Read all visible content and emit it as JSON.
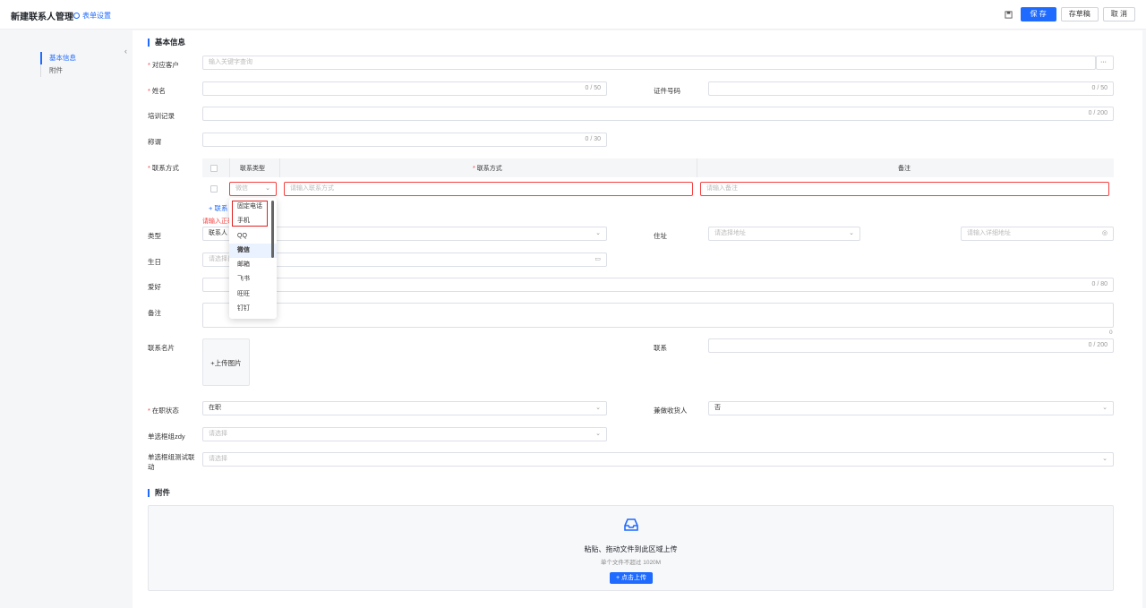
{
  "header": {
    "title": "新建联系人管理",
    "form_settings": "表单设置",
    "save": "保 存",
    "draft": "存草稿",
    "cancel": "取 消"
  },
  "sidebar": {
    "items": [
      {
        "label": "基本信息",
        "active": true
      },
      {
        "label": "附件",
        "active": false
      }
    ]
  },
  "sections": {
    "basic": "基本信息",
    "attachment": "附件"
  },
  "fields": {
    "customer": {
      "label": "对应客户",
      "placeholder": "输入关键字查询",
      "more": "···"
    },
    "name": {
      "label": "姓名",
      "count": "0 / 50"
    },
    "id_number": {
      "label": "证件号码",
      "count": "0 / 50"
    },
    "training": {
      "label": "培训记录",
      "count": "0 / 200"
    },
    "title": {
      "label": "称谓",
      "count": "0 / 30"
    },
    "contact_method": {
      "label": "联系方式"
    },
    "type": {
      "label": "类型",
      "value": "联系人"
    },
    "address": {
      "label": "住址",
      "placeholder": "请选择地址",
      "detail_placeholder": "请输入详细地址"
    },
    "birthday": {
      "label": "生日",
      "placeholder": "请选择日期"
    },
    "hobby": {
      "label": "爱好",
      "count": "0 / 80"
    },
    "remark": {
      "label": "备注",
      "count": "0"
    },
    "card": {
      "label": "联系名片",
      "upload": "+上传图片"
    },
    "contact": {
      "label": "联系",
      "count": "0 / 200"
    },
    "status": {
      "label": "在职状态",
      "value": "在职"
    },
    "receiver": {
      "label": "兼做收货人",
      "value": "否"
    },
    "radio_zdy": {
      "label": "单选框组zdy",
      "placeholder": "请选择"
    },
    "radio_test": {
      "label": "单选框组测试联动",
      "placeholder": "请选择"
    }
  },
  "contact_table": {
    "headers": [
      "联系类型",
      "联系方式",
      "备注"
    ],
    "row": {
      "type_placeholder": "微信",
      "method_placeholder": "请输入联系方式",
      "remark_placeholder": "请输入备注"
    },
    "add_label": "联系",
    "error": "请输入正确"
  },
  "dropdown": {
    "options": [
      "固定电话",
      "手机",
      "QQ",
      "微信",
      "邮箱",
      "飞书",
      "旺旺",
      "钉钉"
    ],
    "selected": "微信"
  },
  "upload": {
    "title": "粘贴、拖动文件到此区域上传",
    "subtitle": "单个文件不超过 1020M",
    "button": "点击上传"
  },
  "colors": {
    "primary": "#1f6bff",
    "error": "#f53f3f"
  }
}
